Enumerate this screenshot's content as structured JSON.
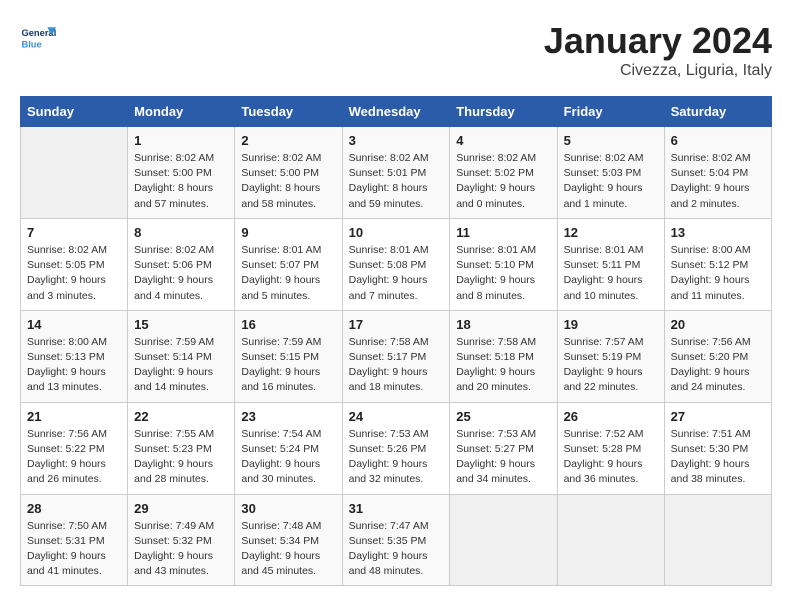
{
  "header": {
    "logo_general": "General",
    "logo_blue": "Blue",
    "title": "January 2024",
    "subtitle": "Civezza, Liguria, Italy"
  },
  "calendar": {
    "days_of_week": [
      "Sunday",
      "Monday",
      "Tuesday",
      "Wednesday",
      "Thursday",
      "Friday",
      "Saturday"
    ],
    "weeks": [
      [
        {
          "day": "",
          "info": ""
        },
        {
          "day": "1",
          "info": "Sunrise: 8:02 AM\nSunset: 5:00 PM\nDaylight: 8 hours\nand 57 minutes."
        },
        {
          "day": "2",
          "info": "Sunrise: 8:02 AM\nSunset: 5:00 PM\nDaylight: 8 hours\nand 58 minutes."
        },
        {
          "day": "3",
          "info": "Sunrise: 8:02 AM\nSunset: 5:01 PM\nDaylight: 8 hours\nand 59 minutes."
        },
        {
          "day": "4",
          "info": "Sunrise: 8:02 AM\nSunset: 5:02 PM\nDaylight: 9 hours\nand 0 minutes."
        },
        {
          "day": "5",
          "info": "Sunrise: 8:02 AM\nSunset: 5:03 PM\nDaylight: 9 hours\nand 1 minute."
        },
        {
          "day": "6",
          "info": "Sunrise: 8:02 AM\nSunset: 5:04 PM\nDaylight: 9 hours\nand 2 minutes."
        }
      ],
      [
        {
          "day": "7",
          "info": "Sunrise: 8:02 AM\nSunset: 5:05 PM\nDaylight: 9 hours\nand 3 minutes."
        },
        {
          "day": "8",
          "info": "Sunrise: 8:02 AM\nSunset: 5:06 PM\nDaylight: 9 hours\nand 4 minutes."
        },
        {
          "day": "9",
          "info": "Sunrise: 8:01 AM\nSunset: 5:07 PM\nDaylight: 9 hours\nand 5 minutes."
        },
        {
          "day": "10",
          "info": "Sunrise: 8:01 AM\nSunset: 5:08 PM\nDaylight: 9 hours\nand 7 minutes."
        },
        {
          "day": "11",
          "info": "Sunrise: 8:01 AM\nSunset: 5:10 PM\nDaylight: 9 hours\nand 8 minutes."
        },
        {
          "day": "12",
          "info": "Sunrise: 8:01 AM\nSunset: 5:11 PM\nDaylight: 9 hours\nand 10 minutes."
        },
        {
          "day": "13",
          "info": "Sunrise: 8:00 AM\nSunset: 5:12 PM\nDaylight: 9 hours\nand 11 minutes."
        }
      ],
      [
        {
          "day": "14",
          "info": "Sunrise: 8:00 AM\nSunset: 5:13 PM\nDaylight: 9 hours\nand 13 minutes."
        },
        {
          "day": "15",
          "info": "Sunrise: 7:59 AM\nSunset: 5:14 PM\nDaylight: 9 hours\nand 14 minutes."
        },
        {
          "day": "16",
          "info": "Sunrise: 7:59 AM\nSunset: 5:15 PM\nDaylight: 9 hours\nand 16 minutes."
        },
        {
          "day": "17",
          "info": "Sunrise: 7:58 AM\nSunset: 5:17 PM\nDaylight: 9 hours\nand 18 minutes."
        },
        {
          "day": "18",
          "info": "Sunrise: 7:58 AM\nSunset: 5:18 PM\nDaylight: 9 hours\nand 20 minutes."
        },
        {
          "day": "19",
          "info": "Sunrise: 7:57 AM\nSunset: 5:19 PM\nDaylight: 9 hours\nand 22 minutes."
        },
        {
          "day": "20",
          "info": "Sunrise: 7:56 AM\nSunset: 5:20 PM\nDaylight: 9 hours\nand 24 minutes."
        }
      ],
      [
        {
          "day": "21",
          "info": "Sunrise: 7:56 AM\nSunset: 5:22 PM\nDaylight: 9 hours\nand 26 minutes."
        },
        {
          "day": "22",
          "info": "Sunrise: 7:55 AM\nSunset: 5:23 PM\nDaylight: 9 hours\nand 28 minutes."
        },
        {
          "day": "23",
          "info": "Sunrise: 7:54 AM\nSunset: 5:24 PM\nDaylight: 9 hours\nand 30 minutes."
        },
        {
          "day": "24",
          "info": "Sunrise: 7:53 AM\nSunset: 5:26 PM\nDaylight: 9 hours\nand 32 minutes."
        },
        {
          "day": "25",
          "info": "Sunrise: 7:53 AM\nSunset: 5:27 PM\nDaylight: 9 hours\nand 34 minutes."
        },
        {
          "day": "26",
          "info": "Sunrise: 7:52 AM\nSunset: 5:28 PM\nDaylight: 9 hours\nand 36 minutes."
        },
        {
          "day": "27",
          "info": "Sunrise: 7:51 AM\nSunset: 5:30 PM\nDaylight: 9 hours\nand 38 minutes."
        }
      ],
      [
        {
          "day": "28",
          "info": "Sunrise: 7:50 AM\nSunset: 5:31 PM\nDaylight: 9 hours\nand 41 minutes."
        },
        {
          "day": "29",
          "info": "Sunrise: 7:49 AM\nSunset: 5:32 PM\nDaylight: 9 hours\nand 43 minutes."
        },
        {
          "day": "30",
          "info": "Sunrise: 7:48 AM\nSunset: 5:34 PM\nDaylight: 9 hours\nand 45 minutes."
        },
        {
          "day": "31",
          "info": "Sunrise: 7:47 AM\nSunset: 5:35 PM\nDaylight: 9 hours\nand 48 minutes."
        },
        {
          "day": "",
          "info": ""
        },
        {
          "day": "",
          "info": ""
        },
        {
          "day": "",
          "info": ""
        }
      ]
    ]
  }
}
